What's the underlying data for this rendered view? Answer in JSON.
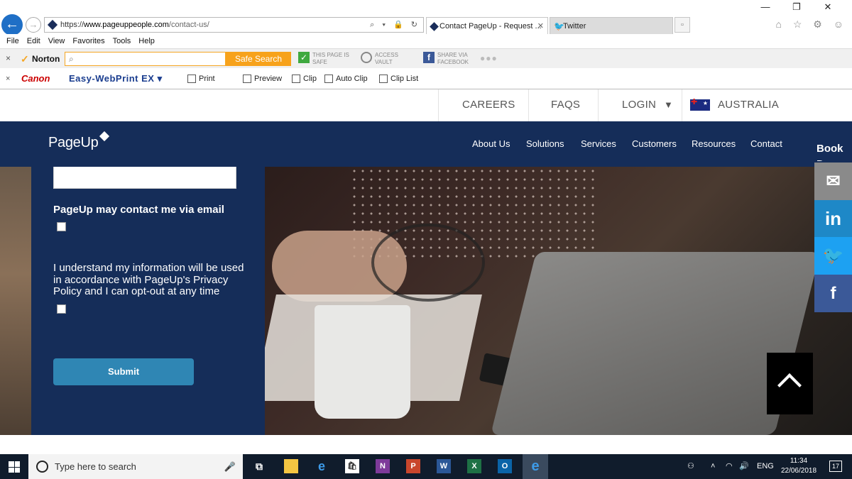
{
  "browser": {
    "url_prefix": "https://",
    "url_host": "www.pageuppeople.com",
    "url_path": "/contact-us/",
    "addr_icons": "⌕ ▾ 🔒 ↻",
    "tabs": [
      {
        "label": "Contact PageUp - Request ...",
        "close": "✕"
      },
      {
        "label": "Twitter"
      }
    ],
    "window_controls": [
      "—",
      "❐",
      "✕"
    ],
    "toolbar_icons": "⌂ ☆ ⚙ ☺",
    "menu": [
      "File",
      "Edit",
      "View",
      "Favorites",
      "Tools",
      "Help"
    ]
  },
  "norton": {
    "close": "×",
    "brand": "Norton",
    "search_placeholder": "",
    "safe_search": "Safe Search",
    "page_safe_l1": "THIS PAGE IS",
    "page_safe_l2": "SAFE",
    "vault_l1": "ACCESS",
    "vault_l2": "VAULT",
    "fb_l1": "SHARE VIA",
    "fb_l2": "FACEBOOK",
    "more": "●●●"
  },
  "canon_bar": {
    "close": "×",
    "brand": "Canon",
    "product": "Easy-WebPrint EX ▾",
    "items": [
      "Print",
      "Preview",
      "Clip",
      "Auto Clip",
      "Clip List"
    ]
  },
  "utility_nav": {
    "careers": "CAREERS",
    "faqs": "FAQS",
    "login": "LOGIN",
    "login_caret": "▼",
    "country": "AUSTRALIA"
  },
  "main_nav": {
    "logo": "PageUp",
    "items": [
      "About Us",
      "Solutions",
      "Services",
      "Customers",
      "Resources",
      "Contact"
    ],
    "book_demo": "Book Demo"
  },
  "form": {
    "name_value": "",
    "email_consent_label": "PageUp may contact me via email",
    "privacy_text": "I understand my information will be used in accordance with PageUp's Privacy Policy and I can opt-out at any time",
    "submit": "Submit"
  },
  "social": {
    "mail_icon": "✉",
    "linkedin": "in",
    "twitter_icon": "🐦",
    "facebook": "f"
  },
  "taskbar": {
    "search_placeholder": "Type here to search",
    "mic_icon": "🎤",
    "apps": {
      "task_view": "⧉",
      "edge": "e",
      "onenote": "N",
      "powerpoint": "P",
      "word": "W",
      "excel": "X",
      "outlook": "O",
      "ie": "e"
    },
    "tray_people": "⚇",
    "tray_caret": "˄",
    "tray_net": "◠",
    "tray_vol": "🔊",
    "lang": "ENG",
    "time": "11:34",
    "date": "22/06/2018",
    "notifications": "17"
  }
}
